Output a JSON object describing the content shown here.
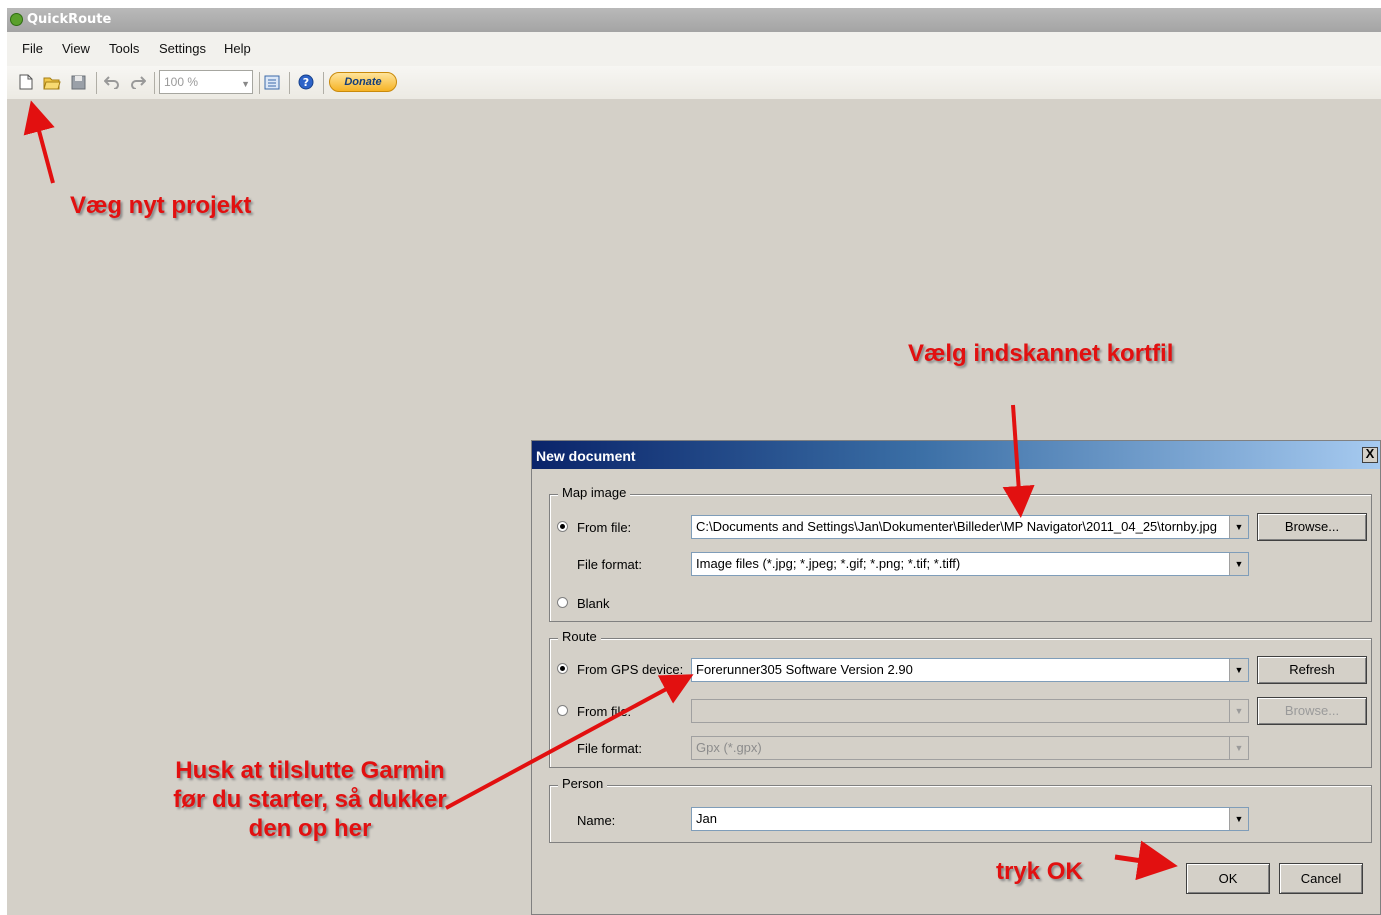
{
  "window": {
    "title": "QuickRoute",
    "icon": "quickroute-app-icon"
  },
  "menu": [
    "File",
    "View",
    "Tools",
    "Settings",
    "Help"
  ],
  "toolbar": {
    "zoom": "100 %",
    "donate_label": "Donate"
  },
  "dialog": {
    "title": "New document",
    "map_image": {
      "group_label": "Map image",
      "from_file_label": "From file:",
      "from_file_value": "C:\\Documents and Settings\\Jan\\Dokumenter\\Billeder\\MP Navigator\\2011_04_25\\tornby.jpg",
      "browse_label": "Browse...",
      "file_format_label": "File format:",
      "file_format_value": "Image files  (*.jpg; *.jpeg; *.gif; *.png; *.tif; *.tiff)",
      "blank_label": "Blank",
      "selected": "from_file"
    },
    "route": {
      "group_label": "Route",
      "from_gps_label": "From GPS device:",
      "from_gps_value": "Forerunner305 Software Version 2.90",
      "refresh_label": "Refresh",
      "from_file_label": "From file:",
      "from_file_value": "",
      "browse_label": "Browse...",
      "file_format_label": "File format:",
      "file_format_value": "Gpx (*.gpx)",
      "selected": "from_gps"
    },
    "person": {
      "group_label": "Person",
      "name_label": "Name:",
      "name_value": "Jan"
    },
    "ok_label": "OK",
    "cancel_label": "Cancel",
    "close_glyph": "X"
  },
  "annotations": {
    "new_project": "Væg nyt projekt",
    "choose_map": "Vælg indskannet kortfil",
    "garmin_line1": "Husk at tilslutte Garmin",
    "garmin_line2": "før du starter, så dukker",
    "garmin_line3": "den op her",
    "press_ok": "tryk OK",
    "color": "#e21010"
  }
}
